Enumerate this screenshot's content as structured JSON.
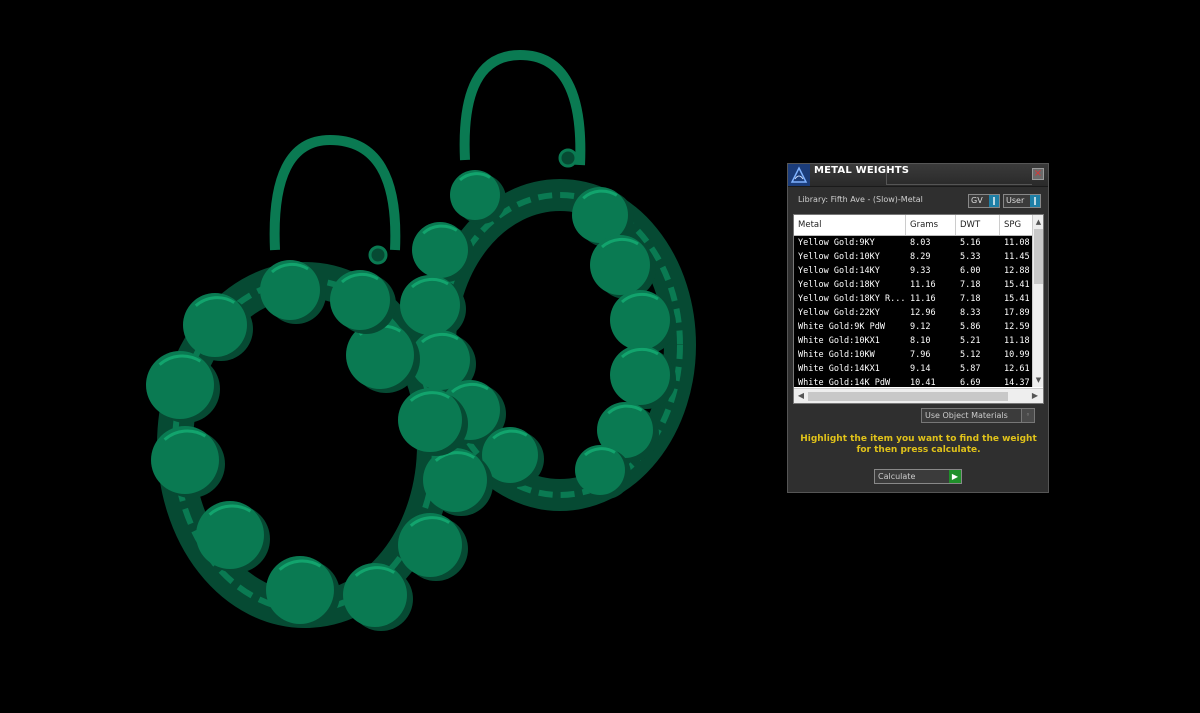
{
  "panel": {
    "title": "METAL WEIGHTS",
    "close_symbol": "×",
    "library_label": "Library: Fifth Ave - (Slow)-Metal",
    "unit_select": "GV",
    "mode_select": "User",
    "select_button_symbol": "‖",
    "materials_select": "Use Object Materials",
    "materials_select_symbol": "◦",
    "hint": "Highlight the item you want to find the weight for then press calculate.",
    "calculate_label": "Calculate",
    "calculate_symbol": "▶",
    "logo_icon": "metal-weights-logo-icon"
  },
  "table": {
    "columns": [
      "Metal",
      "Grams",
      "DWT",
      "SPG"
    ],
    "rows": [
      [
        "Yellow Gold:9KY",
        "8.03",
        "5.16",
        "11.08"
      ],
      [
        "Yellow Gold:10KY",
        "8.29",
        "5.33",
        "11.45"
      ],
      [
        "Yellow Gold:14KY",
        "9.33",
        "6.00",
        "12.88"
      ],
      [
        "Yellow Gold:18KY",
        "11.16",
        "7.18",
        "15.41"
      ],
      [
        "Yellow Gold:18KY R...",
        "11.16",
        "7.18",
        "15.41"
      ],
      [
        "Yellow Gold:22KY",
        "12.96",
        "8.33",
        "17.89"
      ],
      [
        "White Gold:9K PdW",
        "9.12",
        "5.86",
        "12.59"
      ],
      [
        "White Gold:10KX1",
        "8.10",
        "5.21",
        "11.18"
      ],
      [
        "White Gold:10KW",
        "7.96",
        "5.12",
        "10.99"
      ],
      [
        "White Gold:14KX1",
        "9.14",
        "5.87",
        "12.61"
      ],
      [
        "White Gold:14K PdW",
        "10.41",
        "6.69",
        "14.37"
      ]
    ],
    "scroll_up": "▲",
    "scroll_down": "▼",
    "scroll_left": "◀",
    "scroll_right": "▶"
  },
  "viewport": {
    "model_color": "#0a7a52",
    "model_highlight": "#12a46d",
    "model_shadow": "#064a33",
    "background": "#000000"
  }
}
